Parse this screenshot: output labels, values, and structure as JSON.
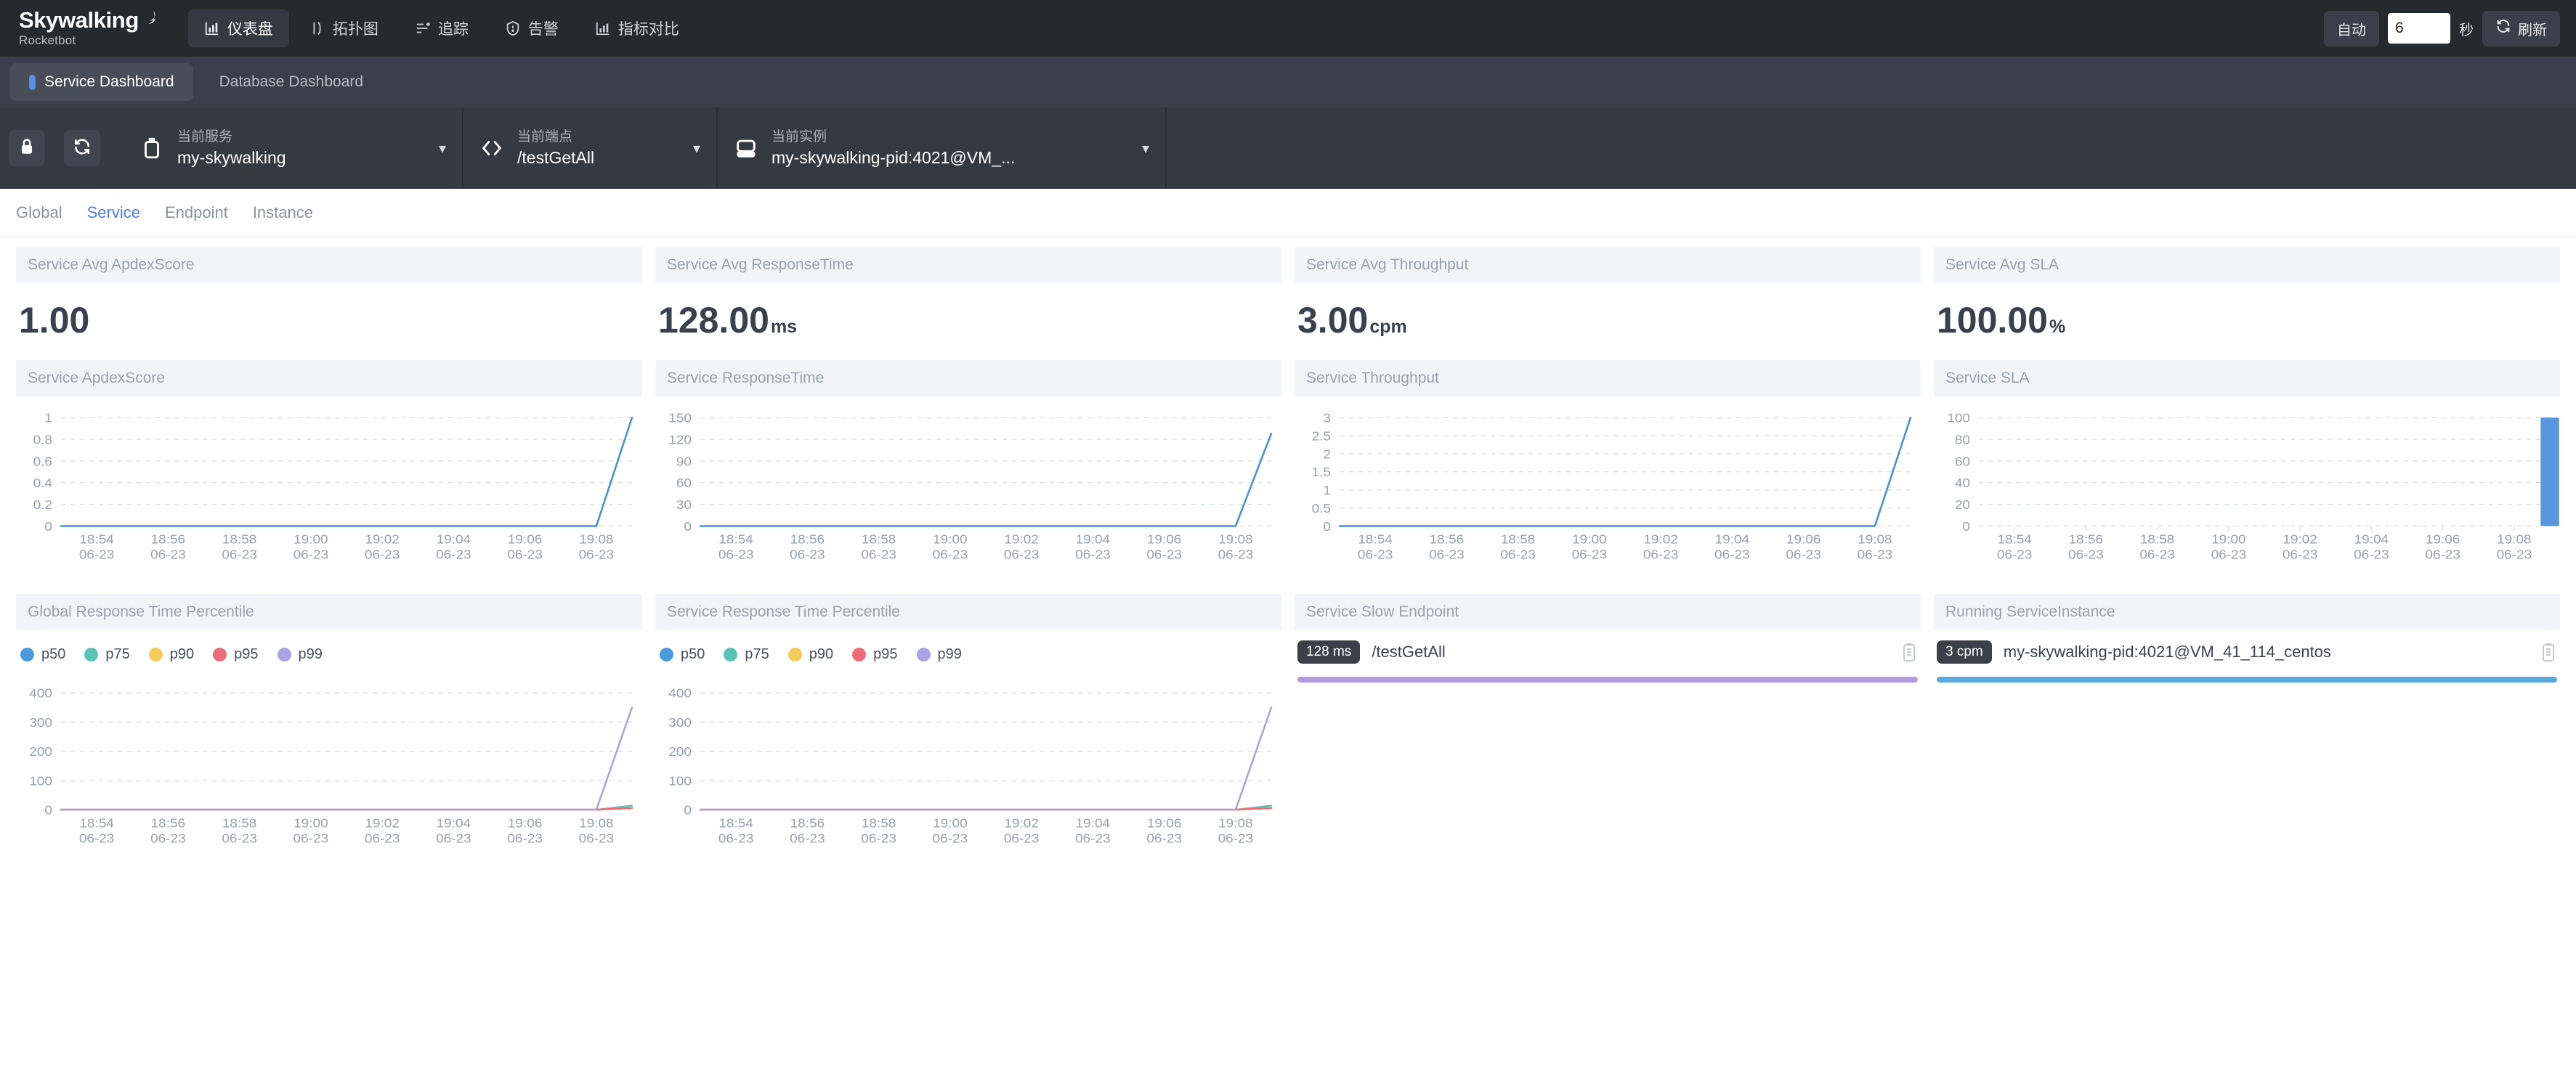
{
  "app": {
    "logo_main": "Skywalking",
    "logo_sub": "Rocketbot"
  },
  "nav": {
    "items": [
      {
        "label": "仪表盘",
        "icon": "chart-bar-icon",
        "active": true
      },
      {
        "label": "拓扑图",
        "icon": "topology-icon",
        "active": false
      },
      {
        "label": "追踪",
        "icon": "trace-icon",
        "active": false
      },
      {
        "label": "告警",
        "icon": "alarm-icon",
        "active": false
      },
      {
        "label": "指标对比",
        "icon": "compare-icon",
        "active": false
      }
    ],
    "auto_label": "自动",
    "interval_value": "6",
    "interval_placeholder": "6",
    "seconds_label": "秒",
    "refresh_label": "刷新"
  },
  "dashboard_tabs": [
    {
      "label": "Service Dashboard",
      "active": true
    },
    {
      "label": "Database Dashboard",
      "active": false
    }
  ],
  "selectors": {
    "tools": [
      "lock-icon",
      "reload-icon"
    ],
    "service": {
      "label": "当前服务",
      "value": "my-skywalking",
      "icon": "service-icon"
    },
    "endpoint": {
      "label": "当前端点",
      "value": "/testGetAll",
      "icon": "code-icon"
    },
    "instance": {
      "label": "当前实例",
      "value": "my-skywalking-pid:4021@VM_...",
      "icon": "instance-icon"
    }
  },
  "subtabs": [
    {
      "label": "Global",
      "active": false
    },
    {
      "label": "Service",
      "active": true
    },
    {
      "label": "Endpoint",
      "active": false
    },
    {
      "label": "Instance",
      "active": false
    }
  ],
  "stats": [
    {
      "title": "Service Avg ApdexScore",
      "value": "1.00",
      "unit": ""
    },
    {
      "title": "Service Avg ResponseTime",
      "value": "128.00",
      "unit": "ms"
    },
    {
      "title": "Service Avg Throughput",
      "value": "3.00",
      "unit": "cpm"
    },
    {
      "title": "Service Avg SLA",
      "value": "100.00",
      "unit": "%"
    }
  ],
  "panels": {
    "apdex_title": "Service ApdexScore",
    "resptime_title": "Service ResponseTime",
    "throughput_title": "Service Throughput",
    "sla_title": "Service SLA",
    "global_pct_title": "Global Response Time Percentile",
    "service_pct_title": "Service Response Time Percentile",
    "slow_endpoint_title": "Service Slow Endpoint",
    "running_instance_title": "Running ServiceInstance"
  },
  "percentile_legend": [
    {
      "label": "p50",
      "color": "#4a9ae0"
    },
    {
      "label": "p75",
      "color": "#57c4b4"
    },
    {
      "label": "p90",
      "color": "#f5cb5c"
    },
    {
      "label": "p95",
      "color": "#ed6a78"
    },
    {
      "label": "p99",
      "color": "#a9a3e6"
    }
  ],
  "slow_endpoint": {
    "badge": "128 ms",
    "name": "/testGetAll",
    "bar_color": "#b49ae0",
    "bar_pct": 100,
    "copy_icon": "clipboard-icon"
  },
  "running_instance": {
    "badge": "3 cpm",
    "name": "my-skywalking-pid:4021@VM_41_114_centos",
    "bar_color": "#5aa9dd",
    "bar_pct": 100,
    "copy_icon": "clipboard-icon"
  },
  "chart_data": [
    {
      "id": "apdex",
      "type": "line",
      "title": "Service ApdexScore",
      "xlabel": "",
      "ylabel": "",
      "grid": true,
      "legend": "none",
      "line_color": "#4a8fdd",
      "x": [
        "18:54\n06-23",
        "18:56\n06-23",
        "18:58\n06-23",
        "19:00\n06-23",
        "19:02\n06-23",
        "19:04\n06-23",
        "19:06\n06-23",
        "19:08\n06-23"
      ],
      "ticks_y": [
        0,
        0.2,
        0.4,
        0.6,
        0.8,
        1
      ],
      "ylim": [
        0,
        1
      ],
      "values": [
        0,
        0,
        0,
        0,
        0,
        0,
        0,
        0,
        0,
        0,
        0,
        0,
        0,
        0,
        0,
        0,
        1
      ]
    },
    {
      "id": "resptime",
      "type": "line",
      "title": "Service ResponseTime",
      "xlabel": "",
      "ylabel": "",
      "grid": true,
      "legend": "none",
      "line_color": "#4a8fdd",
      "x": [
        "18:54\n06-23",
        "18:56\n06-23",
        "18:58\n06-23",
        "19:00\n06-23",
        "19:02\n06-23",
        "19:04\n06-23",
        "19:06\n06-23",
        "19:08\n06-23"
      ],
      "ticks_y": [
        0,
        30,
        60,
        90,
        120,
        150
      ],
      "ylim": [
        0,
        150
      ],
      "values": [
        0,
        0,
        0,
        0,
        0,
        0,
        0,
        0,
        0,
        0,
        0,
        0,
        0,
        0,
        0,
        0,
        128
      ]
    },
    {
      "id": "throughput",
      "type": "line",
      "title": "Service Throughput",
      "xlabel": "",
      "ylabel": "",
      "grid": true,
      "legend": "none",
      "line_color": "#4a8fdd",
      "x": [
        "18:54\n06-23",
        "18:56\n06-23",
        "18:58\n06-23",
        "19:00\n06-23",
        "19:02\n06-23",
        "19:04\n06-23",
        "19:06\n06-23",
        "19:08\n06-23"
      ],
      "ticks_y": [
        0,
        0.5,
        1,
        1.5,
        2,
        2.5,
        3
      ],
      "ylim": [
        0,
        3
      ],
      "values": [
        0,
        0,
        0,
        0,
        0,
        0,
        0,
        0,
        0,
        0,
        0,
        0,
        0,
        0,
        0,
        0,
        3
      ]
    },
    {
      "id": "sla",
      "type": "bar",
      "title": "Service SLA",
      "xlabel": "",
      "ylabel": "",
      "grid": true,
      "legend": "none",
      "bar_color": "#5a96dd",
      "x": [
        "18:54\n06-23",
        "18:56\n06-23",
        "18:58\n06-23",
        "19:00\n06-23",
        "19:02\n06-23",
        "19:04\n06-23",
        "19:06\n06-23",
        "19:08\n06-23"
      ],
      "ticks_y": [
        0,
        20,
        40,
        60,
        80,
        100
      ],
      "ylim": [
        0,
        100
      ],
      "values": [
        0,
        0,
        0,
        0,
        0,
        0,
        0,
        0,
        0,
        0,
        0,
        0,
        0,
        0,
        0,
        0,
        100
      ]
    },
    {
      "id": "global_percentile",
      "type": "line",
      "title": "Global Response Time Percentile",
      "xlabel": "",
      "ylabel": "",
      "grid": true,
      "legend": "top",
      "x": [
        "18:54\n06-23",
        "18:56\n06-23",
        "18:58\n06-23",
        "19:00\n06-23",
        "19:02\n06-23",
        "19:04\n06-23",
        "19:06\n06-23",
        "19:08\n06-23"
      ],
      "ticks_y": [
        0,
        100,
        200,
        300,
        400
      ],
      "ylim": [
        0,
        420
      ],
      "series": [
        {
          "name": "p50",
          "color": "#4a9ae0",
          "values": [
            0,
            0,
            0,
            0,
            0,
            0,
            0,
            0,
            0,
            0,
            0,
            0,
            0,
            0,
            0,
            0,
            6
          ]
        },
        {
          "name": "p75",
          "color": "#57c4b4",
          "values": [
            0,
            0,
            0,
            0,
            0,
            0,
            0,
            0,
            0,
            0,
            0,
            0,
            0,
            0,
            0,
            0,
            14
          ]
        },
        {
          "name": "p90",
          "color": "#f5cb5c",
          "values": [
            0,
            0,
            0,
            0,
            0,
            0,
            0,
            0,
            0,
            0,
            0,
            0,
            0,
            0,
            0,
            0,
            6
          ]
        },
        {
          "name": "p95",
          "color": "#ed6a78",
          "values": [
            0,
            0,
            0,
            0,
            0,
            0,
            0,
            0,
            0,
            0,
            0,
            0,
            0,
            0,
            0,
            0,
            6
          ]
        },
        {
          "name": "p99",
          "color": "#a9a3e6",
          "values": [
            0,
            0,
            0,
            0,
            0,
            0,
            0,
            0,
            0,
            0,
            0,
            0,
            0,
            0,
            0,
            0,
            350
          ]
        }
      ]
    },
    {
      "id": "service_percentile",
      "type": "line",
      "title": "Service Response Time Percentile",
      "xlabel": "",
      "ylabel": "",
      "grid": true,
      "legend": "top",
      "x": [
        "18:54\n06-23",
        "18:56\n06-23",
        "18:58\n06-23",
        "19:00\n06-23",
        "19:02\n06-23",
        "19:04\n06-23",
        "19:06\n06-23",
        "19:08\n06-23"
      ],
      "ticks_y": [
        0,
        100,
        200,
        300,
        400
      ],
      "ylim": [
        0,
        420
      ],
      "series": [
        {
          "name": "p50",
          "color": "#4a9ae0",
          "values": [
            0,
            0,
            0,
            0,
            0,
            0,
            0,
            0,
            0,
            0,
            0,
            0,
            0,
            0,
            0,
            0,
            6
          ]
        },
        {
          "name": "p75",
          "color": "#57c4b4",
          "values": [
            0,
            0,
            0,
            0,
            0,
            0,
            0,
            0,
            0,
            0,
            0,
            0,
            0,
            0,
            0,
            0,
            14
          ]
        },
        {
          "name": "p90",
          "color": "#f5cb5c",
          "values": [
            0,
            0,
            0,
            0,
            0,
            0,
            0,
            0,
            0,
            0,
            0,
            0,
            0,
            0,
            0,
            0,
            6
          ]
        },
        {
          "name": "p95",
          "color": "#ed6a78",
          "values": [
            0,
            0,
            0,
            0,
            0,
            0,
            0,
            0,
            0,
            0,
            0,
            0,
            0,
            0,
            0,
            0,
            6
          ]
        },
        {
          "name": "p99",
          "color": "#a9a3e6",
          "values": [
            0,
            0,
            0,
            0,
            0,
            0,
            0,
            0,
            0,
            0,
            0,
            0,
            0,
            0,
            0,
            0,
            350
          ]
        }
      ]
    }
  ]
}
